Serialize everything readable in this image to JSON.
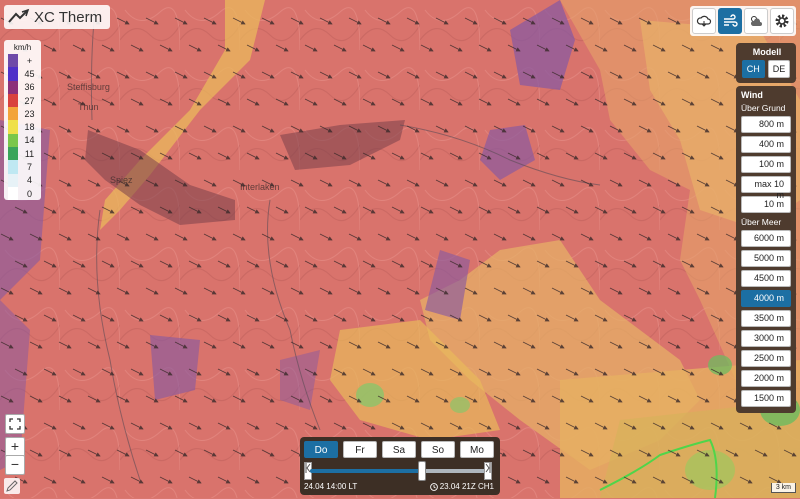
{
  "app": {
    "title": "XC Therm"
  },
  "legend": {
    "unit": "km/h",
    "entries": [
      {
        "label": "+",
        "color": "#6f4aa8"
      },
      {
        "label": "45",
        "color": "#4f30c8"
      },
      {
        "label": "36",
        "color": "#8c2f7a"
      },
      {
        "label": "27",
        "color": "#d9413e"
      },
      {
        "label": "23",
        "color": "#f3a43a"
      },
      {
        "label": "18",
        "color": "#efe04a"
      },
      {
        "label": "14",
        "color": "#7ac74a"
      },
      {
        "label": "11",
        "color": "#3aa55a"
      },
      {
        "label": "7",
        "color": "#bfe8f2"
      },
      {
        "label": "4",
        "color": "#e7f2f7"
      },
      {
        "label": "0",
        "color": "#ffffff"
      }
    ]
  },
  "map": {
    "places": [
      "Steffisburg",
      "Thun",
      "Spiez",
      "Interlaken"
    ],
    "scale_label": "3 km"
  },
  "top_buttons": [
    "cloud-sun-icon",
    "wind-icon",
    "sun-cloud-icon",
    "settings-icon"
  ],
  "model_panel": {
    "title": "Modell",
    "options": [
      "CH",
      "DE"
    ],
    "selected": "CH"
  },
  "wind_panel": {
    "title": "Wind",
    "ground_label": "Über Grund",
    "ground_levels": [
      "800 m",
      "400 m",
      "100 m",
      "max 10 m",
      "10 m"
    ],
    "sea_label": "Über Meer",
    "sea_levels": [
      "6000 m",
      "5000 m",
      "4500 m",
      "4000 m",
      "3500 m",
      "3000 m",
      "2500 m",
      "2000 m",
      "1500 m"
    ],
    "selected": "4000 m"
  },
  "time": {
    "days": [
      "Do",
      "Fr",
      "Sa",
      "So",
      "Mo"
    ],
    "selected_day": "Do",
    "position_fraction": 0.62,
    "local_time": "24.04 14:00 LT",
    "model_run": "23.04 21Z CH1"
  },
  "zoom": {
    "in": "+",
    "out": "−"
  },
  "colors": {
    "accent": "#1c6fa3",
    "panel_bg": "#4e3b2e"
  }
}
